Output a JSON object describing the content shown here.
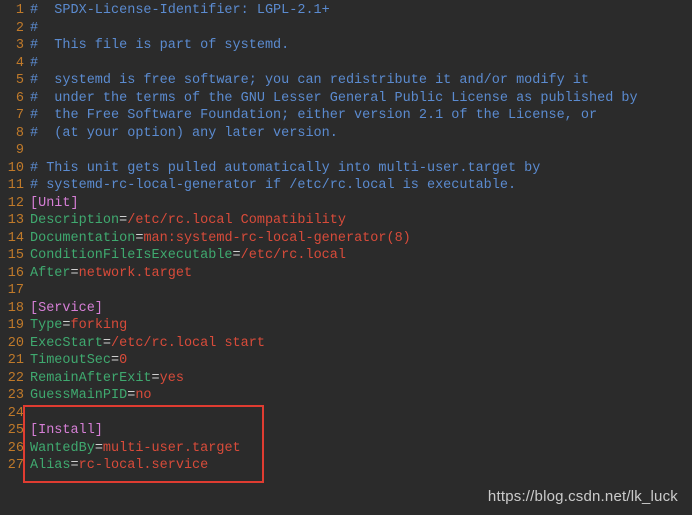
{
  "watermark": "https://blog.csdn.net/lk_luck",
  "lines": [
    {
      "n": 1,
      "segs": [
        {
          "cls": "c-comment",
          "t": "#  SPDX-License-Identifier: LGPL-2.1+"
        }
      ]
    },
    {
      "n": 2,
      "segs": [
        {
          "cls": "c-comment",
          "t": "#"
        }
      ]
    },
    {
      "n": 3,
      "segs": [
        {
          "cls": "c-comment",
          "t": "#  This file is part of systemd."
        }
      ]
    },
    {
      "n": 4,
      "segs": [
        {
          "cls": "c-comment",
          "t": "#"
        }
      ]
    },
    {
      "n": 5,
      "segs": [
        {
          "cls": "c-comment",
          "t": "#  systemd is free software; you can redistribute it and/or modify it"
        }
      ]
    },
    {
      "n": 6,
      "segs": [
        {
          "cls": "c-comment",
          "t": "#  under the terms of the GNU Lesser General Public License as published by"
        }
      ]
    },
    {
      "n": 7,
      "segs": [
        {
          "cls": "c-comment",
          "t": "#  the Free Software Foundation; either version 2.1 of the License, or"
        }
      ]
    },
    {
      "n": 8,
      "segs": [
        {
          "cls": "c-comment",
          "t": "#  (at your option) any later version."
        }
      ]
    },
    {
      "n": 9,
      "segs": []
    },
    {
      "n": 10,
      "segs": [
        {
          "cls": "c-comment",
          "t": "# This unit gets pulled automatically into multi-user.target by"
        }
      ]
    },
    {
      "n": 11,
      "segs": [
        {
          "cls": "c-comment",
          "t": "# systemd-rc-local-generator if /etc/rc.local is executable."
        }
      ]
    },
    {
      "n": 12,
      "segs": [
        {
          "cls": "c-section",
          "t": "[Unit]"
        }
      ]
    },
    {
      "n": 13,
      "segs": [
        {
          "cls": "c-key",
          "t": "Description"
        },
        {
          "cls": "c-eq",
          "t": "="
        },
        {
          "cls": "c-val-red",
          "t": "/etc/rc.local Compatibility"
        }
      ]
    },
    {
      "n": 14,
      "segs": [
        {
          "cls": "c-key",
          "t": "Documentation"
        },
        {
          "cls": "c-eq",
          "t": "="
        },
        {
          "cls": "c-val-red",
          "t": "man:systemd-rc-local-generator(8)"
        }
      ]
    },
    {
      "n": 15,
      "segs": [
        {
          "cls": "c-key",
          "t": "ConditionFileIsExecutable"
        },
        {
          "cls": "c-eq",
          "t": "="
        },
        {
          "cls": "c-val-red",
          "t": "/etc/rc.local"
        }
      ]
    },
    {
      "n": 16,
      "segs": [
        {
          "cls": "c-key",
          "t": "After"
        },
        {
          "cls": "c-eq",
          "t": "="
        },
        {
          "cls": "c-val-red",
          "t": "network.target"
        }
      ]
    },
    {
      "n": 17,
      "segs": []
    },
    {
      "n": 18,
      "segs": [
        {
          "cls": "c-section",
          "t": "[Service]"
        }
      ]
    },
    {
      "n": 19,
      "segs": [
        {
          "cls": "c-key",
          "t": "Type"
        },
        {
          "cls": "c-eq",
          "t": "="
        },
        {
          "cls": "c-val-red",
          "t": "forking"
        }
      ]
    },
    {
      "n": 20,
      "segs": [
        {
          "cls": "c-key",
          "t": "ExecStart"
        },
        {
          "cls": "c-eq",
          "t": "="
        },
        {
          "cls": "c-val-red",
          "t": "/etc/rc.local start"
        }
      ]
    },
    {
      "n": 21,
      "segs": [
        {
          "cls": "c-key",
          "t": "TimeoutSec"
        },
        {
          "cls": "c-eq",
          "t": "="
        },
        {
          "cls": "c-val-red",
          "t": "0"
        }
      ]
    },
    {
      "n": 22,
      "segs": [
        {
          "cls": "c-key",
          "t": "RemainAfterExit"
        },
        {
          "cls": "c-eq",
          "t": "="
        },
        {
          "cls": "c-val-red",
          "t": "yes"
        }
      ]
    },
    {
      "n": 23,
      "segs": [
        {
          "cls": "c-key",
          "t": "GuessMainPID"
        },
        {
          "cls": "c-eq",
          "t": "="
        },
        {
          "cls": "c-val-red",
          "t": "no"
        }
      ]
    },
    {
      "n": 24,
      "segs": []
    },
    {
      "n": 25,
      "segs": [
        {
          "cls": "c-section",
          "t": "[Install]"
        }
      ]
    },
    {
      "n": 26,
      "segs": [
        {
          "cls": "c-key",
          "t": "WantedBy"
        },
        {
          "cls": "c-eq",
          "t": "="
        },
        {
          "cls": "c-val-red",
          "t": "multi-user.target"
        }
      ]
    },
    {
      "n": 27,
      "segs": [
        {
          "cls": "c-key",
          "t": "Alias"
        },
        {
          "cls": "c-eq",
          "t": "="
        },
        {
          "cls": "c-val-red",
          "t": "rc-local.service"
        }
      ]
    }
  ]
}
